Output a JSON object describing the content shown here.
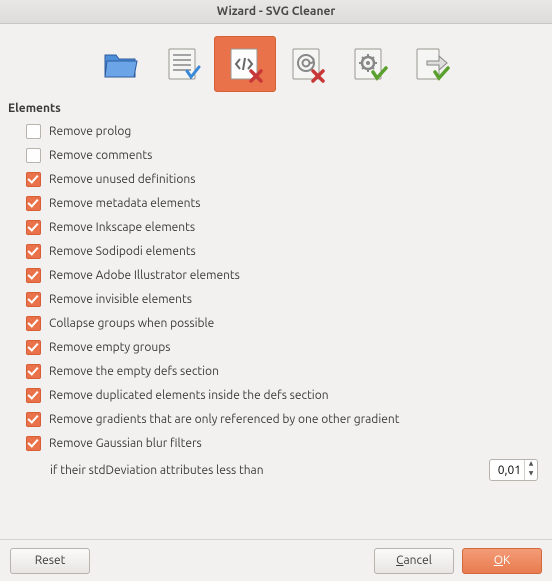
{
  "window": {
    "title": "Wizard - SVG Cleaner"
  },
  "toolbar": {
    "items": [
      {
        "name": "files",
        "selected": false
      },
      {
        "name": "presets",
        "selected": false
      },
      {
        "name": "elements",
        "selected": true
      },
      {
        "name": "attributes",
        "selected": false
      },
      {
        "name": "optimize",
        "selected": false
      },
      {
        "name": "output",
        "selected": false
      }
    ]
  },
  "section": {
    "title": "Elements"
  },
  "options": [
    {
      "label": "Remove prolog",
      "checked": false
    },
    {
      "label": "Remove comments",
      "checked": false
    },
    {
      "label": "Remove unused definitions",
      "checked": true
    },
    {
      "label": "Remove metadata elements",
      "checked": true
    },
    {
      "label": "Remove Inkscape elements",
      "checked": true
    },
    {
      "label": "Remove Sodipodi elements",
      "checked": true
    },
    {
      "label": "Remove Adobe Illustrator elements",
      "checked": true
    },
    {
      "label": "Remove invisible elements",
      "checked": true
    },
    {
      "label": "Collapse groups when possible",
      "checked": true
    },
    {
      "label": "Remove empty groups",
      "checked": true
    },
    {
      "label": "Remove the empty defs section",
      "checked": true
    },
    {
      "label": "Remove duplicated elements inside the defs section",
      "checked": true
    },
    {
      "label": "Remove gradients that are only referenced by one other gradient",
      "checked": true
    },
    {
      "label": "Remove Gaussian blur filters",
      "checked": true
    }
  ],
  "gaussian": {
    "sub_label": "if their stdDeviation attributes less than",
    "value": "0,01"
  },
  "footer": {
    "reset": "Reset",
    "cancel_pre": "",
    "cancel_accel": "C",
    "cancel_post": "ancel",
    "ok_pre": "",
    "ok_accel": "O",
    "ok_post": "K"
  }
}
